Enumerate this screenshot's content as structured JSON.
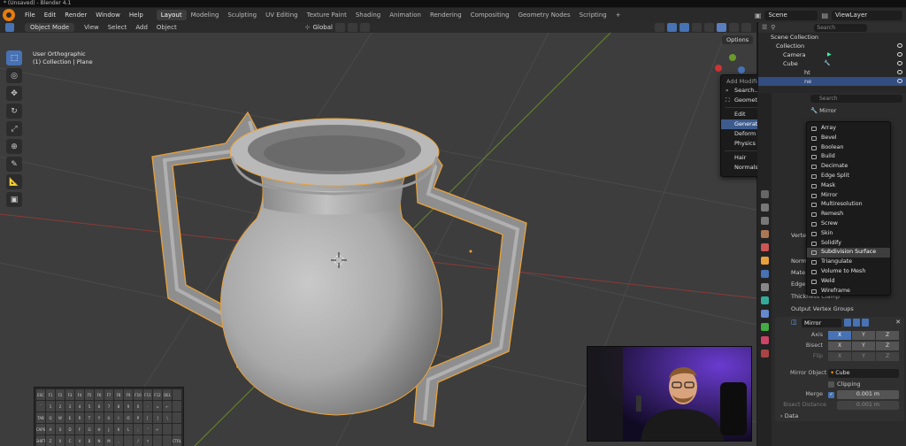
{
  "window": {
    "title": "* (Unsaved) - Blender 4.1"
  },
  "topbar": {
    "menus": [
      "File",
      "Edit",
      "Render",
      "Window",
      "Help"
    ],
    "workspaces": [
      "Layout",
      "Modeling",
      "Sculpting",
      "UV Editing",
      "Texture Paint",
      "Shading",
      "Animation",
      "Rendering",
      "Compositing",
      "Geometry Nodes",
      "Scripting",
      "+"
    ],
    "active_workspace": "Layout",
    "scene": "Scene",
    "view_layer": "ViewLayer"
  },
  "viewport_header": {
    "mode": "Object Mode",
    "menus": [
      "View",
      "Select",
      "Add",
      "Object"
    ],
    "orientation": "Global"
  },
  "viewport": {
    "view_name": "User Orthographic",
    "collection_info": "(1) Collection | Plane",
    "options_label": "Options"
  },
  "add_modifier_menu": {
    "title": "Add Modifier",
    "search": "Search...",
    "geometry_nodes": "Geometry Nodes",
    "items": [
      {
        "label": "Edit",
        "arrow": "▸"
      },
      {
        "label": "Generate",
        "arrow": "▸"
      },
      {
        "label": "Deform",
        "arrow": "▸"
      },
      {
        "label": "Physics",
        "arrow": "▸"
      }
    ],
    "items2": [
      {
        "label": "Hair",
        "arrow": "▸"
      },
      {
        "label": "Normals",
        "arrow": "▸"
      }
    ]
  },
  "generate_menu": {
    "items": [
      "Array",
      "Bevel",
      "Boolean",
      "Build",
      "Decimate",
      "Edge Split",
      "Mask",
      "Mirror",
      "Multiresolution",
      "Remesh",
      "Screw",
      "Skin",
      "Solidify",
      "Subdivision Surface",
      "Triangulate",
      "Volume to Mesh",
      "Weld",
      "Wireframe"
    ],
    "highlighted": "Subdivision Surface"
  },
  "outliner": {
    "search_placeholder": "Search",
    "rows": [
      "Scene Collection",
      "Collection",
      "Camera",
      "Cube",
      "ht",
      "ne"
    ]
  },
  "properties": {
    "search_placeholder": "Search",
    "modifier_header": "Mirror",
    "partial_labels": [
      "Verte",
      "Norm",
      "Mate",
      "Edge"
    ],
    "thickness_clamp": "Thickness Clamp",
    "output_vertex_groups": "Output Vertex Groups",
    "mirror_panel": {
      "name": "Mirror",
      "axis_label": "Axis",
      "bisect_label": "Bisect",
      "flip_label": "Flip",
      "xyz": [
        "X",
        "Y",
        "Z"
      ],
      "mirror_object_label": "Mirror Object",
      "mirror_object": "Cube",
      "clipping": "Clipping",
      "merge_label": "Merge",
      "merge_value": "0.001 m",
      "bisect_distance_label": "Bisect Distance",
      "bisect_distance_value": "0.001 m",
      "data_label": "Data"
    }
  },
  "keyboard": {
    "rows": [
      [
        "ESC",
        "F1",
        "F2",
        "F3",
        "F4",
        "F5",
        "F6",
        "F7",
        "F8",
        "F9",
        "F10",
        "F11",
        "F12",
        "DEL",
        ""
      ],
      [
        "`",
        "1",
        "2",
        "3",
        "4",
        "5",
        "6",
        "7",
        "8",
        "9",
        "0",
        "-",
        "=",
        "←",
        ""
      ],
      [
        "TAB",
        "Q",
        "W",
        "E",
        "R",
        "T",
        "Y",
        "U",
        "I",
        "O",
        "P",
        "[",
        "]",
        "\\",
        ""
      ],
      [
        "CAPS",
        "A",
        "S",
        "D",
        "F",
        "G",
        "H",
        "J",
        "K",
        "L",
        ";",
        "'",
        "↵",
        "",
        ""
      ],
      [
        "SHIFT",
        "Z",
        "X",
        "C",
        "V",
        "B",
        "N",
        "M",
        ",",
        ".",
        "/",
        "↑",
        "",
        ""
      ],
      [
        "CTRL",
        "WIN",
        "ALT",
        "",
        "",
        "",
        "←",
        "↓",
        "→"
      ]
    ]
  },
  "colors": {
    "accent_blue": "#4772b3",
    "selection_orange": "#e8a13a",
    "viewport_bg": "#3d3d3d"
  }
}
